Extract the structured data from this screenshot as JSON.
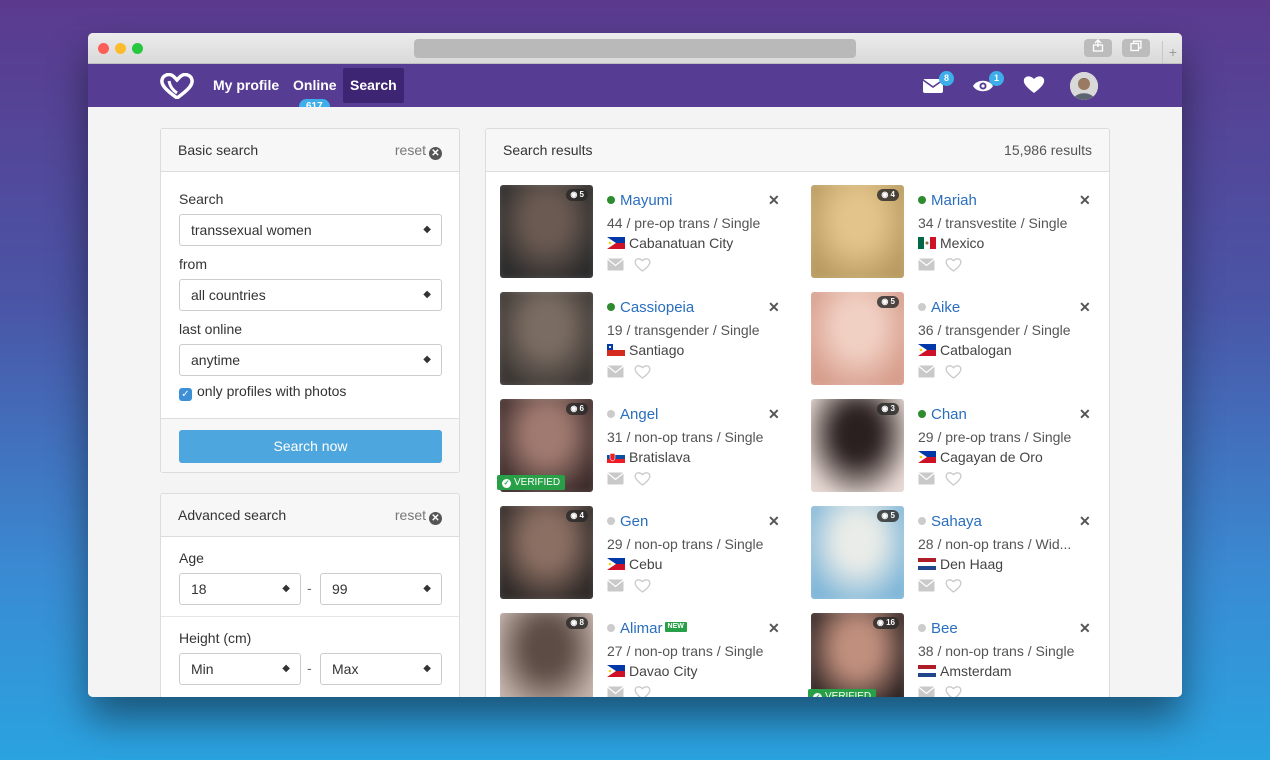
{
  "nav": {
    "my_profile": "My profile",
    "online": "Online",
    "online_count": "617",
    "search": "Search",
    "messages_count": "8",
    "views_count": "1"
  },
  "basic_search": {
    "title": "Basic search",
    "reset": "reset",
    "search_label": "Search",
    "search_value": "transsexual women",
    "from_label": "from",
    "from_value": "all countries",
    "last_online_label": "last online",
    "last_online_value": "anytime",
    "photos_only_label": "only profiles with photos",
    "photos_only_checked": true,
    "button": "Search now"
  },
  "advanced_search": {
    "title": "Advanced search",
    "reset": "reset",
    "age_label": "Age",
    "age_min": "18",
    "age_max": "99",
    "range_sep": "-",
    "height_label": "Height (cm)",
    "height_min": "Min",
    "height_max": "Max"
  },
  "results": {
    "title": "Search results",
    "count": "15,986 results",
    "profiles": [
      {
        "name": "Mayumi",
        "details": "44 / pre-op trans / Single",
        "location": "Cabanatuan City",
        "country": "philippines",
        "online": true,
        "photos": "5",
        "verified": false,
        "is_new": false
      },
      {
        "name": "Mariah",
        "details": "34 / transvestite / Single",
        "location": "Mexico",
        "country": "mexico",
        "online": true,
        "photos": "4",
        "verified": false,
        "is_new": false
      },
      {
        "name": "Cassiopeia",
        "details": "19 / transgender / Single",
        "location": "Santiago",
        "country": "chile",
        "online": true,
        "photos": "",
        "verified": false,
        "is_new": false
      },
      {
        "name": "Aike",
        "details": "36 / transgender / Single",
        "location": "Catbalogan",
        "country": "philippines",
        "online": false,
        "photos": "5",
        "verified": false,
        "is_new": false
      },
      {
        "name": "Angel",
        "details": "31 / non-op trans / Single",
        "location": "Bratislava",
        "country": "slovakia",
        "online": false,
        "photos": "6",
        "verified": true,
        "is_new": false
      },
      {
        "name": "Chan",
        "details": "29 / pre-op trans / Single",
        "location": "Cagayan de Oro",
        "country": "philippines",
        "online": true,
        "photos": "3",
        "verified": false,
        "is_new": false
      },
      {
        "name": "Gen",
        "details": "29 / non-op trans / Single",
        "location": "Cebu",
        "country": "philippines",
        "online": false,
        "photos": "4",
        "verified": false,
        "is_new": false
      },
      {
        "name": "Sahaya",
        "details": "28 / non-op trans / Wid...",
        "location": "Den Haag",
        "country": "netherlands",
        "online": false,
        "photos": "5",
        "verified": false,
        "is_new": false
      },
      {
        "name": "Alimar",
        "details": "27 / non-op trans / Single",
        "location": "Davao City",
        "country": "philippines",
        "online": false,
        "photos": "8",
        "verified": false,
        "is_new": true
      },
      {
        "name": "Bee",
        "details": "38 / non-op trans / Single",
        "location": "Amsterdam",
        "country": "netherlands",
        "online": false,
        "photos": "16",
        "verified": true,
        "is_new": false
      }
    ],
    "verified_label": "VERIFIED",
    "new_label": "NEW"
  },
  "colors": {
    "navbar": "#573c93",
    "link": "#2a6ebd",
    "accent": "#4ea6de",
    "online": "#2e8b2e",
    "verified": "#27a047"
  }
}
